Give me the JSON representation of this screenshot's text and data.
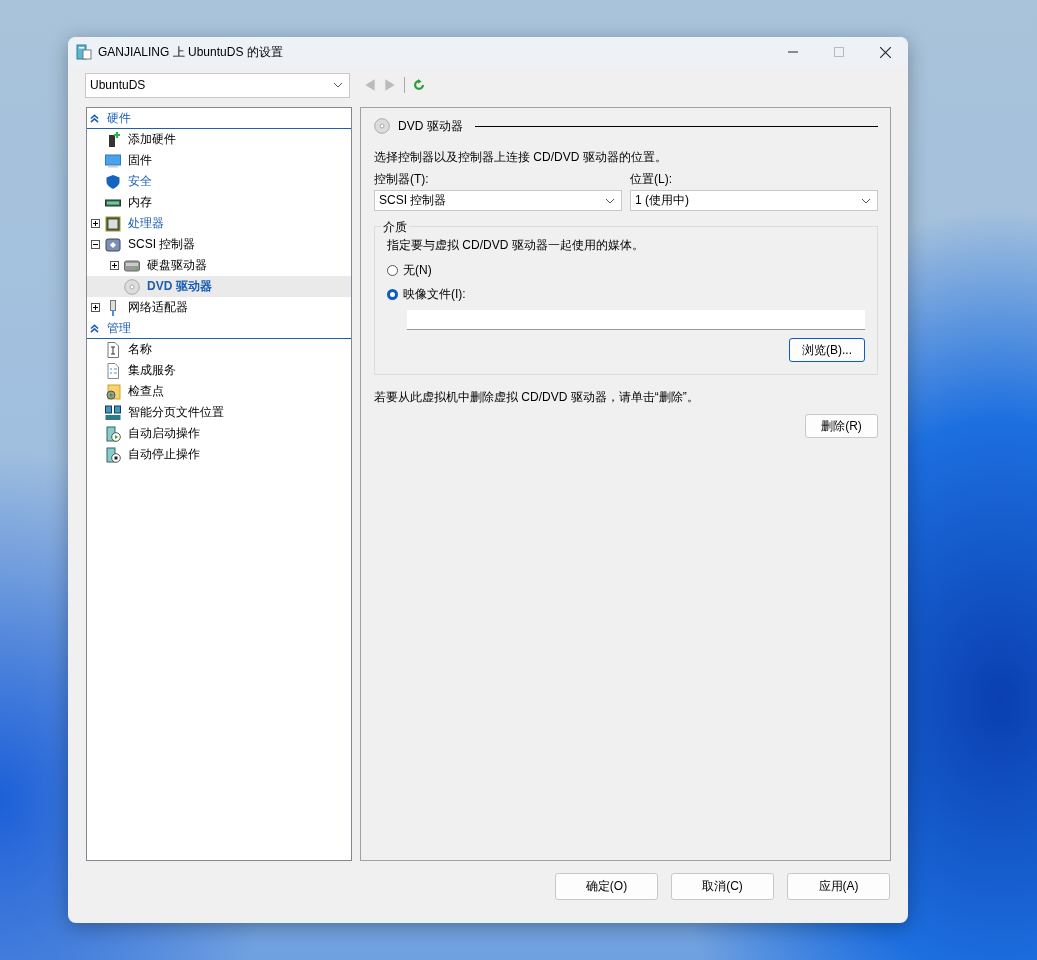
{
  "window": {
    "title": "GANJIALING 上 UbuntuDS 的设置"
  },
  "vm_select": {
    "value": "UbuntuDS"
  },
  "tree": [
    {
      "label": "硬件",
      "items": [
        {
          "label": "添加硬件",
          "kind": "add",
          "highlighted": false,
          "selected": false
        },
        {
          "label": "固件",
          "kind": "monitor",
          "highlighted": false,
          "selected": false
        },
        {
          "label": "安全",
          "kind": "shield",
          "highlighted": true,
          "selected": false
        },
        {
          "label": "内存",
          "kind": "memory",
          "highlighted": false,
          "selected": false
        },
        {
          "label": "处理器",
          "kind": "cpu",
          "highlighted": true,
          "selected": false,
          "expanded": false
        },
        {
          "label": "SCSI 控制器",
          "kind": "controller",
          "highlighted": false,
          "selected": false,
          "expanded": true,
          "children": [
            {
              "label": "硬盘驱动器",
              "kind": "disk",
              "highlighted": false,
              "selected": false,
              "expanded": false
            },
            {
              "label": "DVD 驱动器",
              "kind": "dvd",
              "highlighted": false,
              "selected": true
            }
          ]
        },
        {
          "label": "网络适配器",
          "kind": "network",
          "highlighted": false,
          "selected": false,
          "expanded": false
        }
      ]
    },
    {
      "label": "管理",
      "items": [
        {
          "label": "名称",
          "kind": "name",
          "highlighted": false,
          "selected": false
        },
        {
          "label": "集成服务",
          "kind": "checklist",
          "highlighted": false,
          "selected": false
        },
        {
          "label": "检查点",
          "kind": "checkpoint",
          "highlighted": false,
          "selected": false
        },
        {
          "label": "智能分页文件位置",
          "kind": "paging",
          "highlighted": false,
          "selected": false
        },
        {
          "label": "自动启动操作",
          "kind": "autostart",
          "highlighted": false,
          "selected": false
        },
        {
          "label": "自动停止操作",
          "kind": "autostop",
          "highlighted": false,
          "selected": false
        }
      ]
    }
  ],
  "panel": {
    "title": "DVD 驱动器",
    "description": "选择控制器以及控制器上连接 CD/DVD 驱动器的位置。",
    "controller": {
      "label": "控制器(T):",
      "value": "SCSI 控制器"
    },
    "location": {
      "label": "位置(L):",
      "value": "1 (使用中)"
    },
    "media": {
      "label": "介质",
      "description": "指定要与虚拟 CD/DVD 驱动器一起使用的媒体。",
      "options": [
        {
          "label": "无(N)",
          "selected": false
        },
        {
          "label": "映像文件(I):",
          "selected": true
        }
      ],
      "browse_button": "浏览(B)..."
    },
    "remove_text": "若要从此虚拟机中删除虚拟 CD/DVD 驱动器，请单击“删除”。",
    "remove_button": "删除(R)"
  },
  "buttons": [
    "确定(O)",
    "取消(C)",
    "应用(A)"
  ]
}
